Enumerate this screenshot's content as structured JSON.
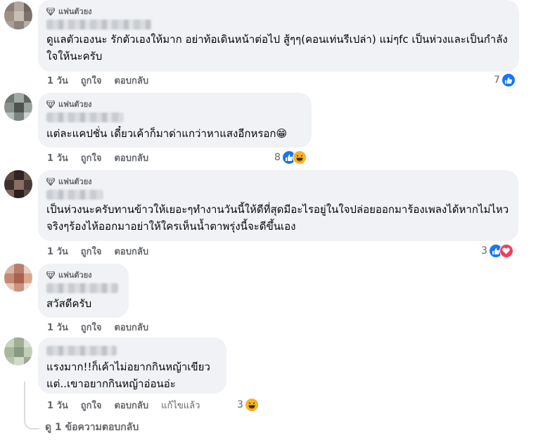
{
  "badge_label": "แฟนตัวยง",
  "comments": [
    {
      "text": "ดูแลตัวเองนะ รักตัวเองให้มาก อย่าท้อเดินหน้าต่อไป สู้ๆๆ(คอนเท่นรีเปล่า) แม่ๆfc เป็นห่วงและเป็นกำลังใจให้นะครับ",
      "time": "1 วัน",
      "like": "ถูกใจ",
      "reply": "ตอบกลับ",
      "reaction_count": "7"
    },
    {
      "text": "แต่ละแคปชั่น เดี๋ยวเค้าก็มาด่าแกว่าหาแสงอีกหรอก😁",
      "time": "1 วัน",
      "like": "ถูกใจ",
      "reply": "ตอบกลับ",
      "reaction_count": "8"
    },
    {
      "text": "เป็นห่วงนะครับทานข้าวให้เยอะๆทำงานวันนี้ให้ดีที่สุดมีอะไรอยู่ในใจปล่อยออกมาร้องเพลงได้หากไม่ไหวจริงๆร้องไห้ออกมาอย่าให้ใครเห็นน้ำตาพรุ่งนี้จะดีขึ้นเอง",
      "time": "1 วัน",
      "like": "ถูกใจ",
      "reply": "ตอบกลับ",
      "reaction_count": "3"
    },
    {
      "text": "สวัสดีครับ",
      "time": "1 วัน",
      "like": "ถูกใจ",
      "reply": "ตอบกลับ"
    },
    {
      "text": "แรงมาก!!ก็เค้าไม่อยากกินหญ้าเขียว\nแต่..เขาอยากกินหญ้าอ่อนอ่ะ",
      "time": "1 วัน",
      "like": "ถูกใจ",
      "reply": "ตอบกลับ",
      "edited": "แก้ไขแล้ว",
      "reaction_count": "3"
    }
  ],
  "view_replies": "ดู 1 ข้อความตอบกลับ",
  "colors": {
    "like": "#1877f2",
    "love": "#f33e58",
    "haha": "#f7b125",
    "bubble": "#f0f2f5"
  },
  "icons": [
    "diamond-icon",
    "like-icon",
    "love-icon",
    "haha-icon"
  ]
}
